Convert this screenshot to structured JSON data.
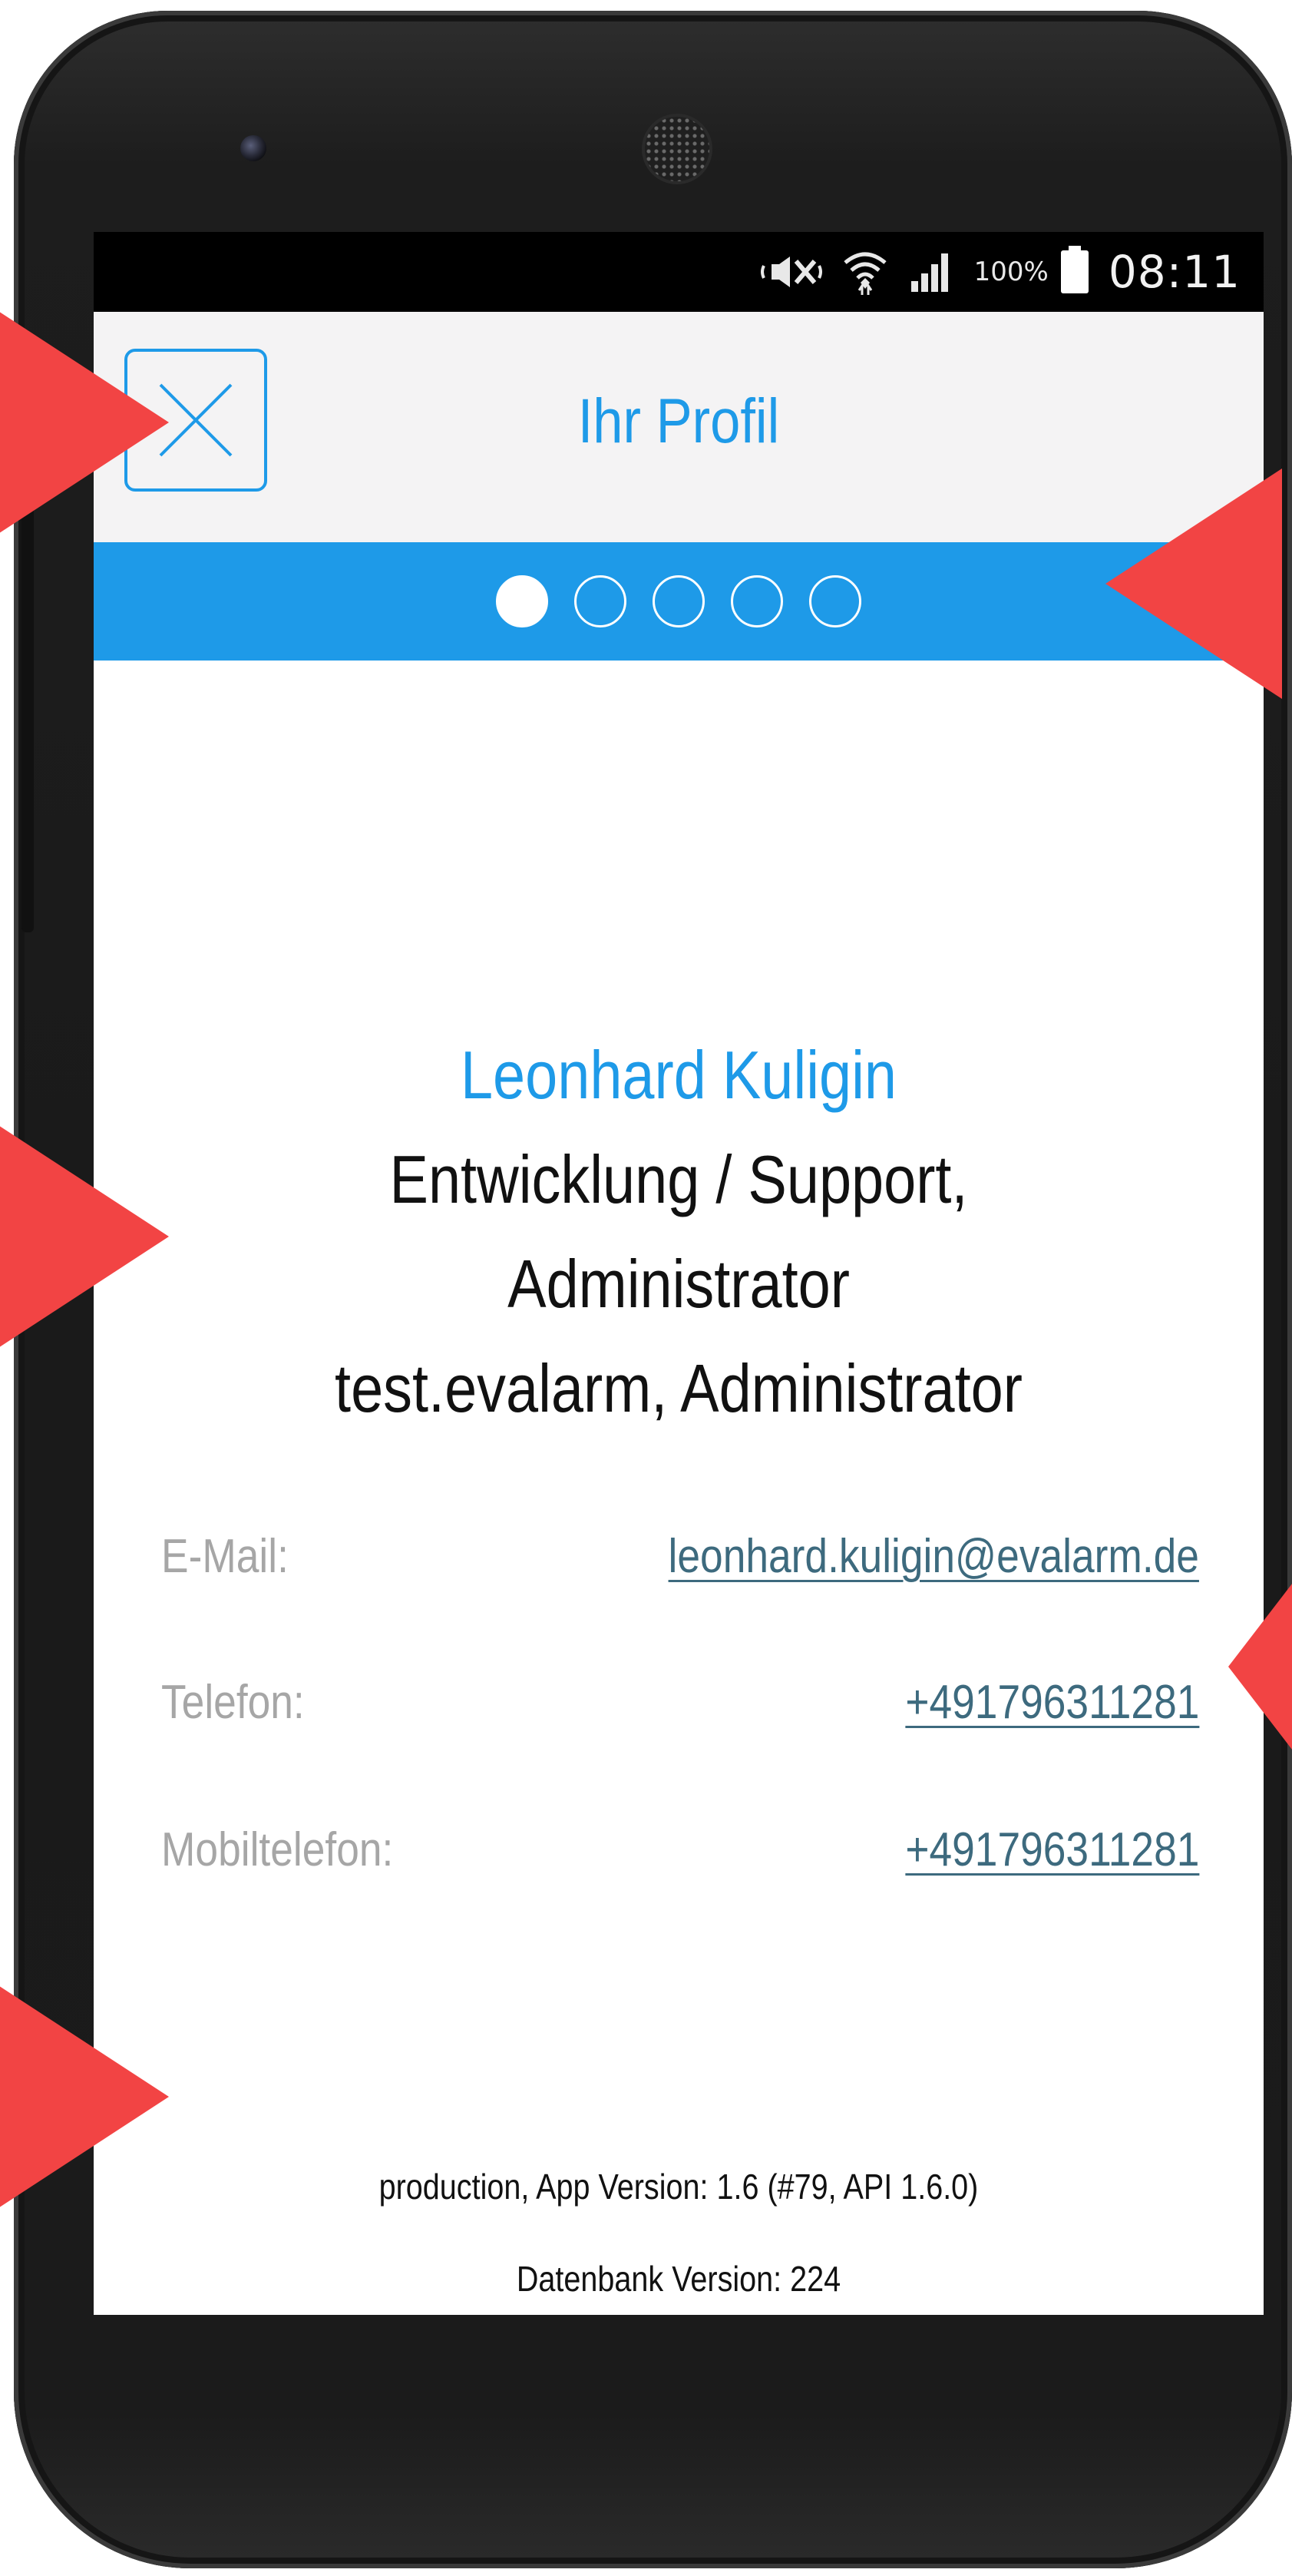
{
  "status_bar": {
    "battery_percent": "100%",
    "time": "08:11",
    "icons": [
      "mute-icon",
      "wifi-icon",
      "signal-icon",
      "battery-icon"
    ]
  },
  "header": {
    "title": "Ihr Profil",
    "close_icon": "close-icon"
  },
  "stepper": {
    "total_steps": 5,
    "active_step": 1
  },
  "profile": {
    "name": "Leonhard Kuligin",
    "role_line_1": "Entwicklung / Support,",
    "role_line_2": "Administrator",
    "org_line": "test.evalarm, Administrator"
  },
  "contacts": [
    {
      "label": "E-Mail:",
      "value": "leonhard.kuligin@evalarm.de"
    },
    {
      "label": "Telefon:",
      "value": "+491796311281"
    },
    {
      "label": "Mobiltelefon:",
      "value": "+491796311281"
    }
  ],
  "footer": {
    "version_line": "production,  App Version: 1.6 (#79, API 1.6.0)",
    "db_line": "Datenbank Version:  224"
  },
  "colors": {
    "accent": "#1e9ae8",
    "annotation": "#f24444",
    "link": "#3d6a7e",
    "label": "#a6a6a6"
  }
}
